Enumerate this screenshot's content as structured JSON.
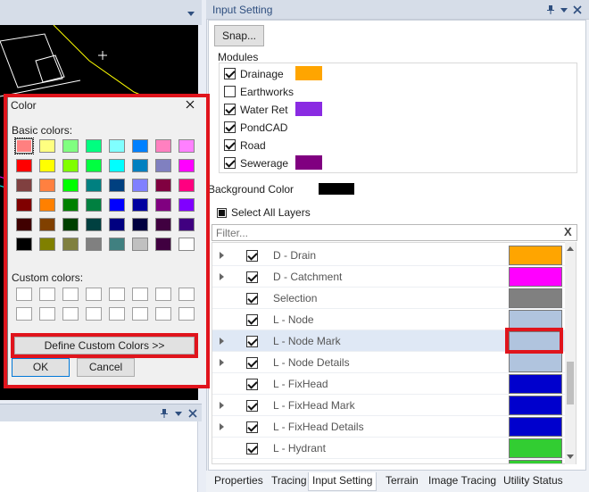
{
  "input_setting": {
    "title": "Input Setting",
    "snap_label": "Snap...",
    "modules_label": "Modules",
    "modules": [
      {
        "label": "Drainage",
        "checked": true,
        "color": "#ffa500"
      },
      {
        "label": "Earthworks",
        "checked": false,
        "color": null
      },
      {
        "label": "Water Ret",
        "checked": true,
        "color": "#8a2be2"
      },
      {
        "label": "PondCAD",
        "checked": true,
        "color": null
      },
      {
        "label": "Road",
        "checked": true,
        "color": null
      },
      {
        "label": "Sewerage",
        "checked": true,
        "color": "#800080"
      }
    ],
    "background_color_label": "Background Color",
    "background_color": "#000000",
    "select_all_label": "Select All Layers",
    "filter_placeholder": "Filter...",
    "filter_clear": "X",
    "layers": [
      {
        "name": "D - Drain",
        "checked": true,
        "expandable": true,
        "color": "#ffa500"
      },
      {
        "name": "D - Catchment",
        "checked": true,
        "expandable": true,
        "color": "#ff00ff"
      },
      {
        "name": "Selection",
        "checked": true,
        "expandable": false,
        "color": "#808080"
      },
      {
        "name": "L - Node",
        "checked": true,
        "expandable": false,
        "color": "#b0c4de"
      },
      {
        "name": "L - Node Mark",
        "checked": true,
        "expandable": true,
        "color": "#b0c4de",
        "selected": true
      },
      {
        "name": "L - Node Details",
        "checked": true,
        "expandable": true,
        "color": "#b0c4de"
      },
      {
        "name": "L - FixHead",
        "checked": true,
        "expandable": false,
        "color": "#0000cd"
      },
      {
        "name": "L - FixHead Mark",
        "checked": true,
        "expandable": true,
        "color": "#0000cd"
      },
      {
        "name": "L - FixHead Details",
        "checked": true,
        "expandable": true,
        "color": "#0000cd"
      },
      {
        "name": "L - Hydrant",
        "checked": true,
        "expandable": false,
        "color": "#32cd32"
      },
      {
        "name": "",
        "checked": true,
        "expandable": true,
        "color": "#32cd32"
      }
    ]
  },
  "tabs": [
    "Properties",
    "Tracing",
    "Input Setting",
    "Terrain",
    "Image Tracing",
    "Utility Status"
  ],
  "active_tab": "Input Setting",
  "color_dialog": {
    "title": "Color",
    "basic_colors_label": "Basic colors:",
    "custom_colors_label": "Custom colors:",
    "define_custom_label": "Define Custom Colors >>",
    "ok_label": "OK",
    "cancel_label": "Cancel",
    "basic_colors": [
      [
        "#ff8080",
        "#ffff80",
        "#80ff80",
        "#00ff80",
        "#80ffff",
        "#0080ff",
        "#ff80c0",
        "#ff80ff"
      ],
      [
        "#ff0000",
        "#ffff00",
        "#80ff00",
        "#00ff40",
        "#00ffff",
        "#0080c0",
        "#8080c0",
        "#ff00ff"
      ],
      [
        "#804040",
        "#ff8040",
        "#00ff00",
        "#008080",
        "#004080",
        "#8080ff",
        "#800040",
        "#ff0080"
      ],
      [
        "#800000",
        "#ff8000",
        "#008000",
        "#008040",
        "#0000ff",
        "#0000a0",
        "#800080",
        "#8000ff"
      ],
      [
        "#400000",
        "#804000",
        "#004000",
        "#004040",
        "#000080",
        "#000040",
        "#400040",
        "#400080"
      ],
      [
        "#000000",
        "#808000",
        "#808040",
        "#808080",
        "#408080",
        "#c0c0c0",
        "#400040",
        "#ffffff"
      ]
    ],
    "selected_basic": [
      0,
      0
    ]
  },
  "colors": {
    "highlight": "#e0141c",
    "panel_title": "#2f4f7f"
  }
}
